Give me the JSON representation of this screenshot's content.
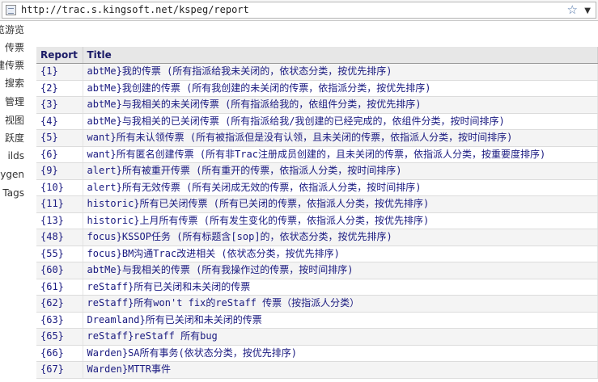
{
  "address_bar": {
    "url": "http://trac.s.kingsoft.net/kspeg/report"
  },
  "nav": {
    "items": [
      "源浏览",
      "查看传票",
      "新建传票",
      "搜索",
      "管理",
      "查看视图",
      "活跃度",
      "Builds",
      "Doxygen",
      "Tags"
    ],
    "visible_text": [
      "览游览",
      "传票",
      "建传票",
      "搜索",
      "管理",
      "视图",
      "跃度",
      "ilds",
      "ygen",
      "Tags"
    ]
  },
  "report_table": {
    "headers": [
      "Report",
      "Title"
    ],
    "rows": [
      {
        "id": "{1}",
        "title": "abtMe}我的传票 (所有指派给我未关闭的，依状态分类，按优先排序)"
      },
      {
        "id": "{2}",
        "title": "abtMe}我创建的传票 (所有我创建的未关闭的传票，依指派分类，按优先排序)"
      },
      {
        "id": "{3}",
        "title": "abtMe}与我相关的未关闭传票 (所有指派给我的，依组件分类，按优先排序)"
      },
      {
        "id": "{4}",
        "title": "abtMe}与我相关的已关闭传票 (所有指派给我/我创建的已经完成的，依组件分类，按时间排序)"
      },
      {
        "id": "{5}",
        "title": "want}所有未认领传票 (所有被指派但是没有认领，且未关闭的传票，依指派人分类，按时间排序)"
      },
      {
        "id": "{6}",
        "title": "want}所有匿名创建传票 (所有非Trac注册成员创建的，且未关闭的传票，依指派人分类，按重要度排序)"
      },
      {
        "id": "{9}",
        "title": "alert}所有被重开传票 (所有重开的传票，依指派人分类，按时间排序)"
      },
      {
        "id": "{10}",
        "title": "alert}所有无效传票 (所有关闭成无效的传票，依指派人分类，按时间排序)"
      },
      {
        "id": "{11}",
        "title": "historic}所有已关闭传票 (所有已关闭的传票，依指派人分类，按优先排序)"
      },
      {
        "id": "{13}",
        "title": "historic}上月所有传票 (所有发生变化的传票，依指派人分类，按优先排序)"
      },
      {
        "id": "{48}",
        "title": "focus}KSSOP任务 (所有标题含[sop]的，依状态分类，按优先排序)"
      },
      {
        "id": "{55}",
        "title": "focus}BM沟通Trac改进相关 (依状态分类，按优先排序)"
      },
      {
        "id": "{60}",
        "title": "abtMe}与我相关的传票 (所有我操作过的传票，按时间排序)"
      },
      {
        "id": "{61}",
        "title": "reStaff}所有已关闭和未关闭的传票"
      },
      {
        "id": "{62}",
        "title": "reStaff}所有won't fix的reStaff 传票（按指派人分类）"
      },
      {
        "id": "{63}",
        "title": "Dreamland}所有已关闭和未关闭的传票"
      },
      {
        "id": "{65}",
        "title": "reStaff}reStaff 所有bug"
      },
      {
        "id": "{66}",
        "title": "Warden}SA所有事务(依状态分类，按优先排序)"
      },
      {
        "id": "{67}",
        "title": "Warden}MTTR事件"
      }
    ]
  }
}
